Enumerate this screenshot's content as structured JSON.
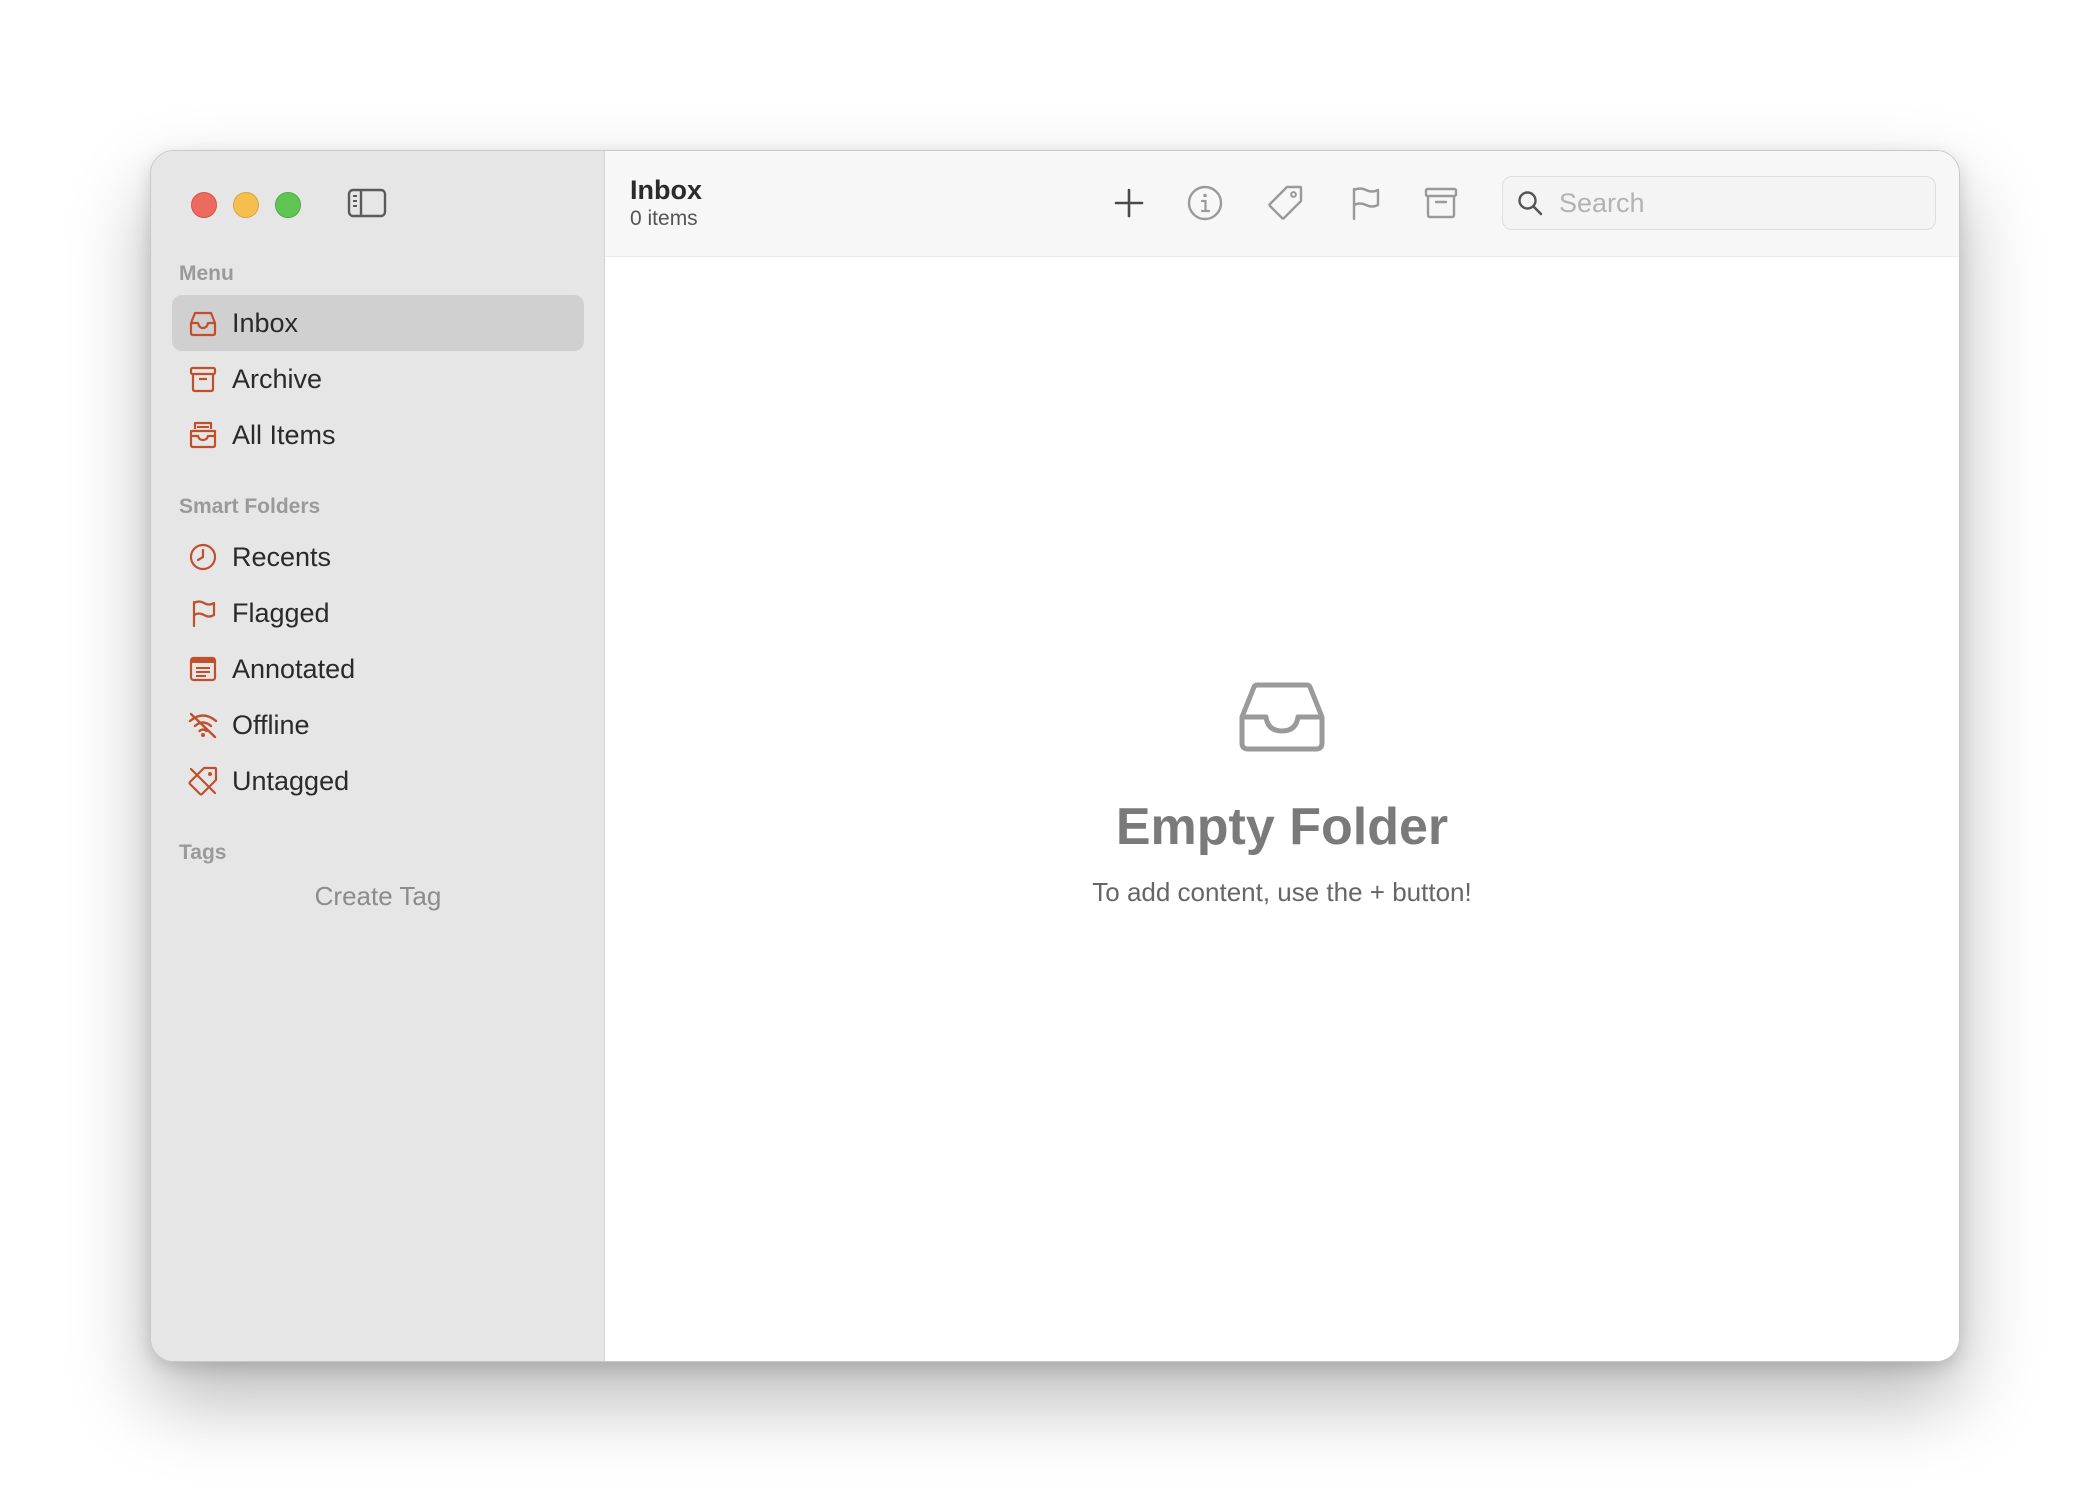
{
  "colors": {
    "accent": "#c0502c",
    "sidebar_bg": "#e6e6e6",
    "selected_bg": "#d0d0d0"
  },
  "window": {
    "traffic_lights": [
      "close",
      "minimize",
      "zoom"
    ]
  },
  "sidebar": {
    "sections": {
      "menu": {
        "label": "Menu"
      },
      "smart_folders": {
        "label": "Smart Folders"
      },
      "tags": {
        "label": "Tags"
      }
    },
    "menu_items": [
      {
        "label": "Inbox",
        "icon": "inbox-icon",
        "selected": true
      },
      {
        "label": "Archive",
        "icon": "archive-icon"
      },
      {
        "label": "All Items",
        "icon": "all-items-icon"
      }
    ],
    "smart_items": [
      {
        "label": "Recents",
        "icon": "clock-icon"
      },
      {
        "label": "Flagged",
        "icon": "flag-icon"
      },
      {
        "label": "Annotated",
        "icon": "annotated-icon"
      },
      {
        "label": "Offline",
        "icon": "wifi-off-icon"
      },
      {
        "label": "Untagged",
        "icon": "tag-off-icon"
      }
    ],
    "create_tag_label": "Create Tag"
  },
  "toolbar": {
    "title": "Inbox",
    "subtitle": "0 items",
    "buttons": [
      "plus-icon",
      "info-icon",
      "tag-icon",
      "flag-icon",
      "archive-icon"
    ],
    "search_placeholder": "Search"
  },
  "empty_state": {
    "icon": "inbox-icon",
    "title": "Empty Folder",
    "subtitle": "To add content, use the + button!"
  }
}
